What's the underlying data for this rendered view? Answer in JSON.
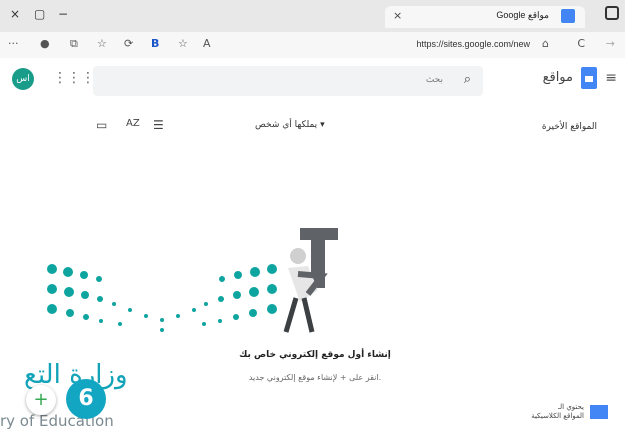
{
  "browser": {
    "close_glyph": "×",
    "restore_glyph": "▢",
    "minimize_glyph": "−",
    "tab_title": "Google مواقع",
    "tab_close": "×",
    "new_tab": "+",
    "url": "https://sites.google.com/new",
    "more_glyph": "···",
    "refresh_glyph": "C",
    "forward_glyph": "→"
  },
  "app": {
    "avatar_initials": "اس",
    "grid_glyph": "⋮⋮⋮",
    "search_placeholder": "بحث",
    "search_glyph": "🔍",
    "brand": "مواقع",
    "menu_glyph": "≡"
  },
  "toolbar": {
    "folder_glyph": "▭",
    "sort_glyph": "A͢Z",
    "list_glyph": "☰",
    "owner_filter": "يملكها أي شخص ▾",
    "recent_label": "المواقع الأخيرة"
  },
  "empty_state": {
    "title": "إنشاء أول موقع إلكتروني خاص بك",
    "subtitle": "انقر على + لإنشاء موقع إلكتروني جديد."
  },
  "classic": {
    "label_line1": "يحتوي الـ",
    "label_line2": "المواقع الكلاسيكية"
  },
  "overlay": {
    "arabic_text": "وزارة التع",
    "english_text": "ry of Education",
    "fab_glyph": "+",
    "badge_number": "6"
  },
  "colors": {
    "accent": "#4285f4",
    "teal": "#13a6c2",
    "avatar": "#1a9c8a"
  }
}
